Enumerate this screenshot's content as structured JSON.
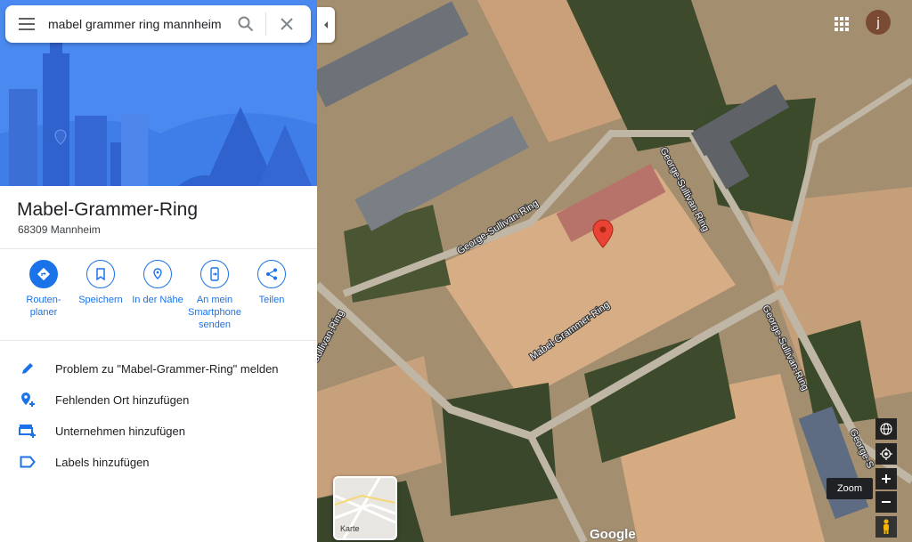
{
  "search": {
    "query": "mabel grammer ring mannheim"
  },
  "place": {
    "title": "Mabel-Grammer-Ring",
    "address": "68309 Mannheim"
  },
  "actions": [
    {
      "label": "Routen-\nplaner",
      "icon": "directions-icon"
    },
    {
      "label": "Speichern",
      "icon": "bookmark-icon"
    },
    {
      "label": "In der Nähe",
      "icon": "nearby-icon"
    },
    {
      "label": "An mein\nSmartphone\nsenden",
      "icon": "send-to-phone-icon"
    },
    {
      "label": "Teilen",
      "icon": "share-icon"
    }
  ],
  "list": [
    {
      "label": "Problem zu \"Mabel-Grammer-Ring\" melden",
      "icon": "pencil-icon"
    },
    {
      "label": "Fehlenden Ort hinzufügen",
      "icon": "add-place-icon"
    },
    {
      "label": "Unternehmen hinzufügen",
      "icon": "add-business-icon"
    },
    {
      "label": "Labels hinzufügen",
      "icon": "label-icon"
    }
  ],
  "map": {
    "road_labels": [
      "George-Sullivan-Ring",
      "George-Sullivan-Ring",
      "Mabel-Grammer-Ring",
      "George-Sullivan-Ring",
      "Sullivan-Ring",
      "George-S"
    ],
    "minimap_label": "Karte",
    "zoom_tooltip": "Zoom",
    "google_logo": "Google",
    "avatar_initial": "j"
  },
  "colors": {
    "accent": "#1a73e8",
    "hero": "#4a8af0",
    "pin": "#ea4335"
  }
}
